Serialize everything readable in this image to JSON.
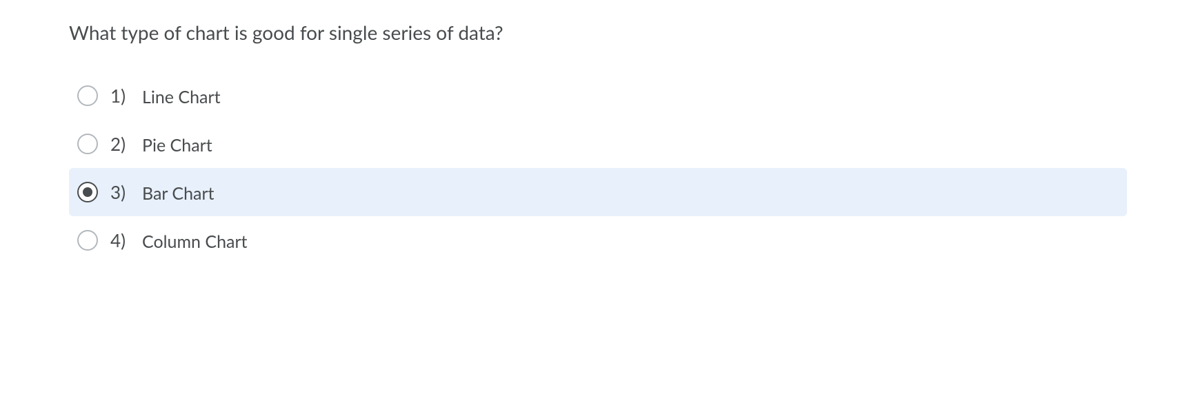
{
  "question": {
    "text": "What type of chart is good for single series of data?",
    "options": [
      {
        "number": "1)",
        "label": "Line Chart",
        "selected": false
      },
      {
        "number": "2)",
        "label": "Pie Chart",
        "selected": false
      },
      {
        "number": "3)",
        "label": "Bar Chart",
        "selected": true
      },
      {
        "number": "4)",
        "label": "Column Chart",
        "selected": false
      }
    ]
  }
}
